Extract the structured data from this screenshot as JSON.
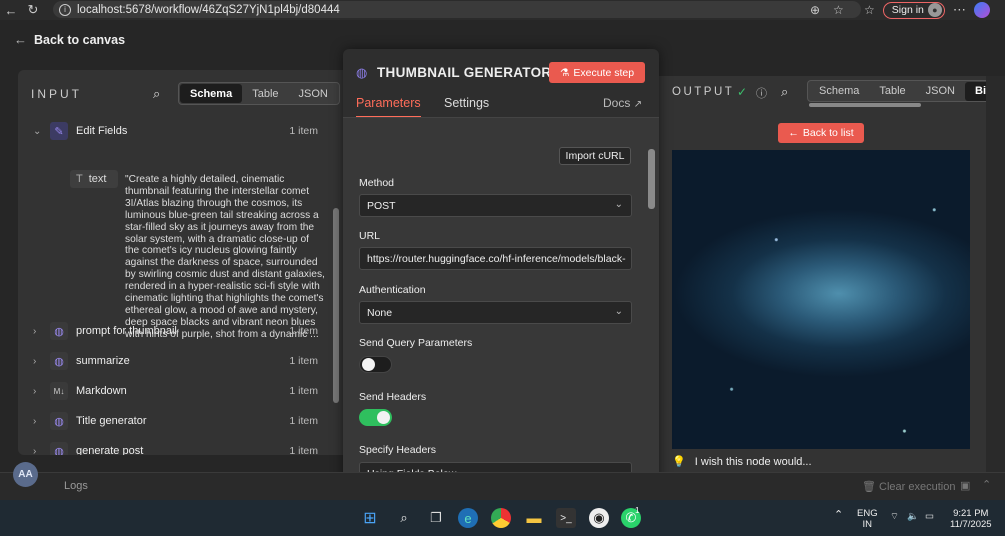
{
  "browser": {
    "url": "localhost:5678/workflow/46ZqS27YjN1pl4bj/d80444",
    "signin_label": "Sign in",
    "more_label": "⋯"
  },
  "app": {
    "back_label": "Back to canvas"
  },
  "input_panel": {
    "title": "INPUT",
    "tabs": [
      "Schema",
      "Table",
      "JSON"
    ],
    "active_tab": "Schema",
    "items": [
      {
        "label": "Edit Fields",
        "count": "1 item",
        "icon": "pencil-icon"
      },
      {
        "label": "prompt for thumbnail",
        "count": "1 item",
        "icon": "globe-icon"
      },
      {
        "label": "summarize",
        "count": "1 item",
        "icon": "globe-icon"
      },
      {
        "label": "Markdown",
        "count": "1 item",
        "icon": "markdown-icon"
      },
      {
        "label": "Title generator",
        "count": "1 item",
        "icon": "globe-icon"
      },
      {
        "label": "generate post",
        "count": "1 item",
        "icon": "globe-icon"
      }
    ],
    "field_name": "text",
    "field_value": "\"Create a highly detailed, cinematic thumbnail featuring the interstellar comet 3I/Atlas blazing through the cosmos, its luminous blue-green tail streaking across a star-filled sky as it journeys away from the solar system, with a dramatic close-up of the comet's icy nucleus glowing faintly against the darkness of space, surrounded by swirling cosmic dust and distant galaxies, rendered in a hyper-realistic sci-fi style with cinematic lighting that highlights the comet's ethereal glow, a mood of awe and mystery, deep space blacks and vibrant neon blues with hints of purple, shot from a dynamic ..."
  },
  "modal": {
    "title": "THUMBNAIL GENERATOR",
    "execute_label": "Execute step",
    "tabs": {
      "parameters": "Parameters",
      "settings": "Settings",
      "docs": "Docs"
    },
    "import_label": "Import cURL",
    "method_label": "Method",
    "method_value": "POST",
    "url_label": "URL",
    "url_value": "https://router.huggingface.co/hf-inference/models/black-",
    "auth_label": "Authentication",
    "auth_value": "None",
    "send_query_label": "Send Query Parameters",
    "send_query_on": false,
    "send_headers_label": "Send Headers",
    "send_headers_on": true,
    "specify_headers_label": "Specify Headers",
    "specify_headers_value": "Using Fields Below"
  },
  "output_panel": {
    "title": "OUTPUT",
    "tabs": [
      "Schema",
      "Table",
      "JSON",
      "Bina"
    ],
    "active_tab": "Bina",
    "back_list_label": "Back to list"
  },
  "footer": {
    "wish_label": "I wish this node would...",
    "logs_label": "Logs",
    "clear_label": "Clear execution",
    "avatar": "AA"
  },
  "taskbar": {
    "lang": "ENG",
    "region": "IN",
    "time": "9:21 PM",
    "date": "11/7/2025",
    "whatsapp_badge": "1"
  },
  "colors": {
    "accent": "#ea5a4f",
    "toggle_on": "#2fbf5e",
    "node_icon": "#8c7ee8"
  }
}
